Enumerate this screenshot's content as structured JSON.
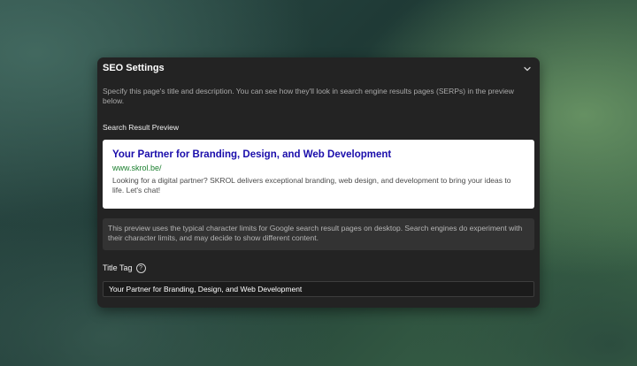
{
  "panel": {
    "title": "SEO Settings",
    "collapse_icon": "chevron-down-icon",
    "intro": "Specify this page's title and description. You can see how they'll look in search engine results pages (SERPs) in the preview below."
  },
  "preview": {
    "heading": "Search Result Preview",
    "title": "Your Partner for Branding, Design, and Web Development",
    "url": "www.skrol.be/",
    "description": "Looking for a digital partner? SKROL delivers exceptional branding, web design, and development to bring your ideas to life. Let's chat!"
  },
  "notice": {
    "text": "This preview uses the typical character limits for Google search result pages on desktop. Search engines do experiment with their character limits, and may decide to show different content."
  },
  "title_tag": {
    "label": "Title Tag",
    "help_icon": "question-circle-icon",
    "value": "Your Partner for Branding, Design, and Web Development"
  },
  "colors": {
    "panel_bg": "#232323",
    "serp_title": "#1a0dab",
    "serp_url": "#1a7f2e"
  }
}
